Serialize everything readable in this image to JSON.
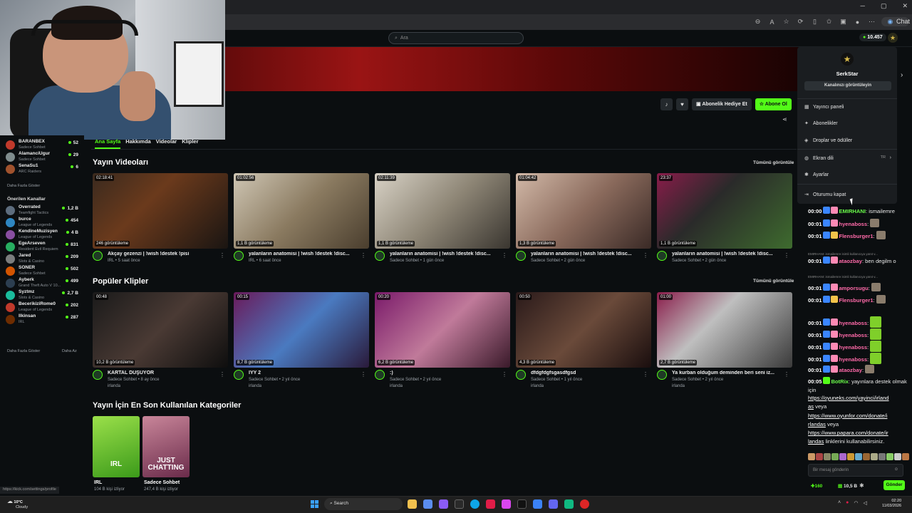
{
  "browser": {
    "chat_extension_label": "Chat"
  },
  "header": {
    "search_placeholder": "Ara",
    "credits": "10.457"
  },
  "sidebar": {
    "followed": [
      {
        "name": "BARANBEX",
        "category": "Sadece Sohbet",
        "viewers": "52",
        "color": "#c0392b"
      },
      {
        "name": "AlamanciUgur",
        "category": "Sadece Sohbet",
        "viewers": "29",
        "color": "#7f8c8d"
      },
      {
        "name": "SenaSu1",
        "category": "ARC Raiders",
        "viewers": "6",
        "color": "#a0522d"
      }
    ],
    "show_more_1": "Daha Fazla Göster",
    "recommended_heading": "Önerilen Kanallar",
    "recommended": [
      {
        "name": "Overrated",
        "category": "Teamfight Tactics",
        "viewers": "1,2 B",
        "color": "#5d6d7e"
      },
      {
        "name": "burce",
        "category": "League of Legends",
        "viewers": "454",
        "color": "#2e86c1"
      },
      {
        "name": "KendineMuzisyen",
        "category": "League of Legends",
        "viewers": "4 B",
        "color": "#884ea0"
      },
      {
        "name": "EgeArseven",
        "category": "Resident Evil Requiem",
        "viewers": "831",
        "color": "#27ae60"
      },
      {
        "name": "Jared",
        "category": "Slots & Casino",
        "viewers": "209",
        "color": "#7b7d7d"
      },
      {
        "name": "SONER",
        "category": "Sadece Sohbet",
        "viewers": "502",
        "color": "#d35400"
      },
      {
        "name": "Ayberk",
        "category": "Grand Theft Auto V 10...",
        "viewers": "499",
        "color": "#2c3e50"
      },
      {
        "name": "Syztmz",
        "category": "Slots & Casino",
        "viewers": "2,7 B",
        "color": "#1abc9c"
      },
      {
        "name": "BecerikiziRome0",
        "category": "League of Legends",
        "viewers": "202",
        "color": "#c0392b"
      },
      {
        "name": "llkinsan",
        "category": "IRL",
        "viewers": "287",
        "color": "#6e2c00"
      }
    ],
    "show_more_2": "Daha Fazla Göster",
    "show_less": "Daha Az"
  },
  "channel": {
    "gift_label": "Abonelik Hediye Et",
    "subscribe_label": "Abone Ol",
    "tabs": [
      "Ana Sayfa",
      "Hakkımda",
      "Videolar",
      "Klipler"
    ]
  },
  "videos": {
    "title": "Yayın Videoları",
    "see_all": "Tümünü görüntüle",
    "items": [
      {
        "duration": "02:18:41",
        "views": "246 görüntüleme",
        "title": "Akçay gezenzi | !wish !destek !pisi",
        "category": "IRL",
        "age": "5 saat önce"
      },
      {
        "duration": "01:02:56",
        "views": "1,1 B görüntüleme",
        "title": "yalanların anatomisi | !wish !destek !disc...",
        "category": "IRL",
        "age": "6 saat önce"
      },
      {
        "duration": "02:11:39",
        "views": "1,1 B görüntüleme",
        "title": "yalanların anatomisi | !wish !destek !disc...",
        "category": "Sadece Sohbet",
        "age": "1 gün önce"
      },
      {
        "duration": "01:04:42",
        "views": "1,3 B görüntüleme",
        "title": "yalanların anatomisi | !wish !destek !disc...",
        "category": "Sadece Sohbet",
        "age": "2 gün önce"
      },
      {
        "duration": "23:37",
        "views": "1,1 B görüntüleme",
        "title": "yalanların anatomisi | !wish !destek !disc...",
        "category": "Sadece Sohbet",
        "age": "2 gün önce"
      }
    ]
  },
  "clips": {
    "title": "Popüler Klipler",
    "see_all": "Tümünü görüntüle",
    "items": [
      {
        "duration": "00:48",
        "views": "10,2 B görüntüleme",
        "title": "KARTAL DÜŞÜYOR",
        "category": "Sadece Sohbet",
        "age": "8 ay önce",
        "author": "irlanda"
      },
      {
        "duration": "00:15",
        "views": "8,7 B görüntüleme",
        "title": "IYY 2",
        "category": "Sadece Sohbet",
        "age": "2 yıl önce",
        "author": "irlanda"
      },
      {
        "duration": "00:20",
        "views": "6,2 B görüntüleme",
        "title": ":)",
        "category": "Sadece Sohbet",
        "age": "2 yıl önce",
        "author": "irlanda"
      },
      {
        "duration": "00:50",
        "views": "4,3 B görüntüleme",
        "title": "dfdgfdgfsgasdfgsd",
        "category": "Sadece Sohbet",
        "age": "1 yıl önce",
        "author": "irlanda"
      },
      {
        "duration": "01:00",
        "views": "2,7 B görüntüleme",
        "title": "Ya kurban olduğum deminden beri seni iz...",
        "category": "Sadece Sohbet",
        "age": "2 yıl önce",
        "author": "irlanda"
      }
    ]
  },
  "categories": {
    "title": "Yayın İçin En Son Kullanılan Kategoriler",
    "items": [
      {
        "name": "IRL",
        "viewers": "104 B kişi izliyor",
        "art": "IRL"
      },
      {
        "name": "Sadece Sohbet",
        "viewers": "247,4 B kişi izliyor",
        "art": "JUST CHATTING"
      }
    ]
  },
  "user_menu": {
    "username": "SerkStar",
    "view_channel": "Kanalınızı görüntüleyin",
    "items": [
      "Yayıncı paneli",
      "Abonelikler",
      "Droplar ve ödüller",
      "Ekran dili",
      "Ayarlar",
      "Oturumu kapat"
    ],
    "language": "TR"
  },
  "chat": {
    "messages": [
      {
        "time": "00:00",
        "user": "EMIRHANI",
        "text": "ismailemre"
      },
      {
        "time": "00:01",
        "user": "hyenaboss",
        "text": ""
      },
      {
        "time": "00:01",
        "user": "Flensburger1",
        "text": ""
      },
      {
        "reply": "EMIRHANI: ismailemre isimli kullanıcıya yanıt v..."
      },
      {
        "time": "00:01",
        "user": "ataozbay",
        "text": "ben degilm o"
      },
      {
        "reply": "EMIRHANI: ismailemre isimli kullanıcıya yanıt v..."
      },
      {
        "time": "00:01",
        "user": "amporsugu",
        "text": ""
      },
      {
        "time": "00:01",
        "user": "Flensburger1",
        "text": ""
      },
      {
        "time": "00:01",
        "user": "hyenaboss",
        "text": ""
      },
      {
        "time": "00:01",
        "user": "hyenaboss",
        "text": ""
      },
      {
        "time": "00:01",
        "user": "hyenaboss",
        "text": ""
      },
      {
        "time": "00:01",
        "user": "hyenaboss",
        "text": ""
      },
      {
        "time": "00:01",
        "user": "ataozbay",
        "text": ""
      },
      {
        "time": "00:05",
        "user": "BotRix",
        "text": "yayınlara destek olmak için"
      }
    ],
    "links": [
      "https://oyuneks.com/yayinci/irland",
      "as",
      "veya",
      "https://www.oyunfor.com/donate/i",
      "rlandas",
      "veya",
      "https://www.papara.com/donate/ir",
      "landas",
      "linklerini kullanabilirsiniz."
    ],
    "input_placeholder": "Bir mesaj gönderin",
    "points": "160",
    "kicks": "10,5 B",
    "send_label": "Gönder"
  },
  "status_url": "https://kick.com/settings/profile",
  "taskbar": {
    "temperature": "10°C",
    "weather": "Cloudy",
    "search": "Search",
    "time": "02:20",
    "date": "11/03/2026"
  }
}
